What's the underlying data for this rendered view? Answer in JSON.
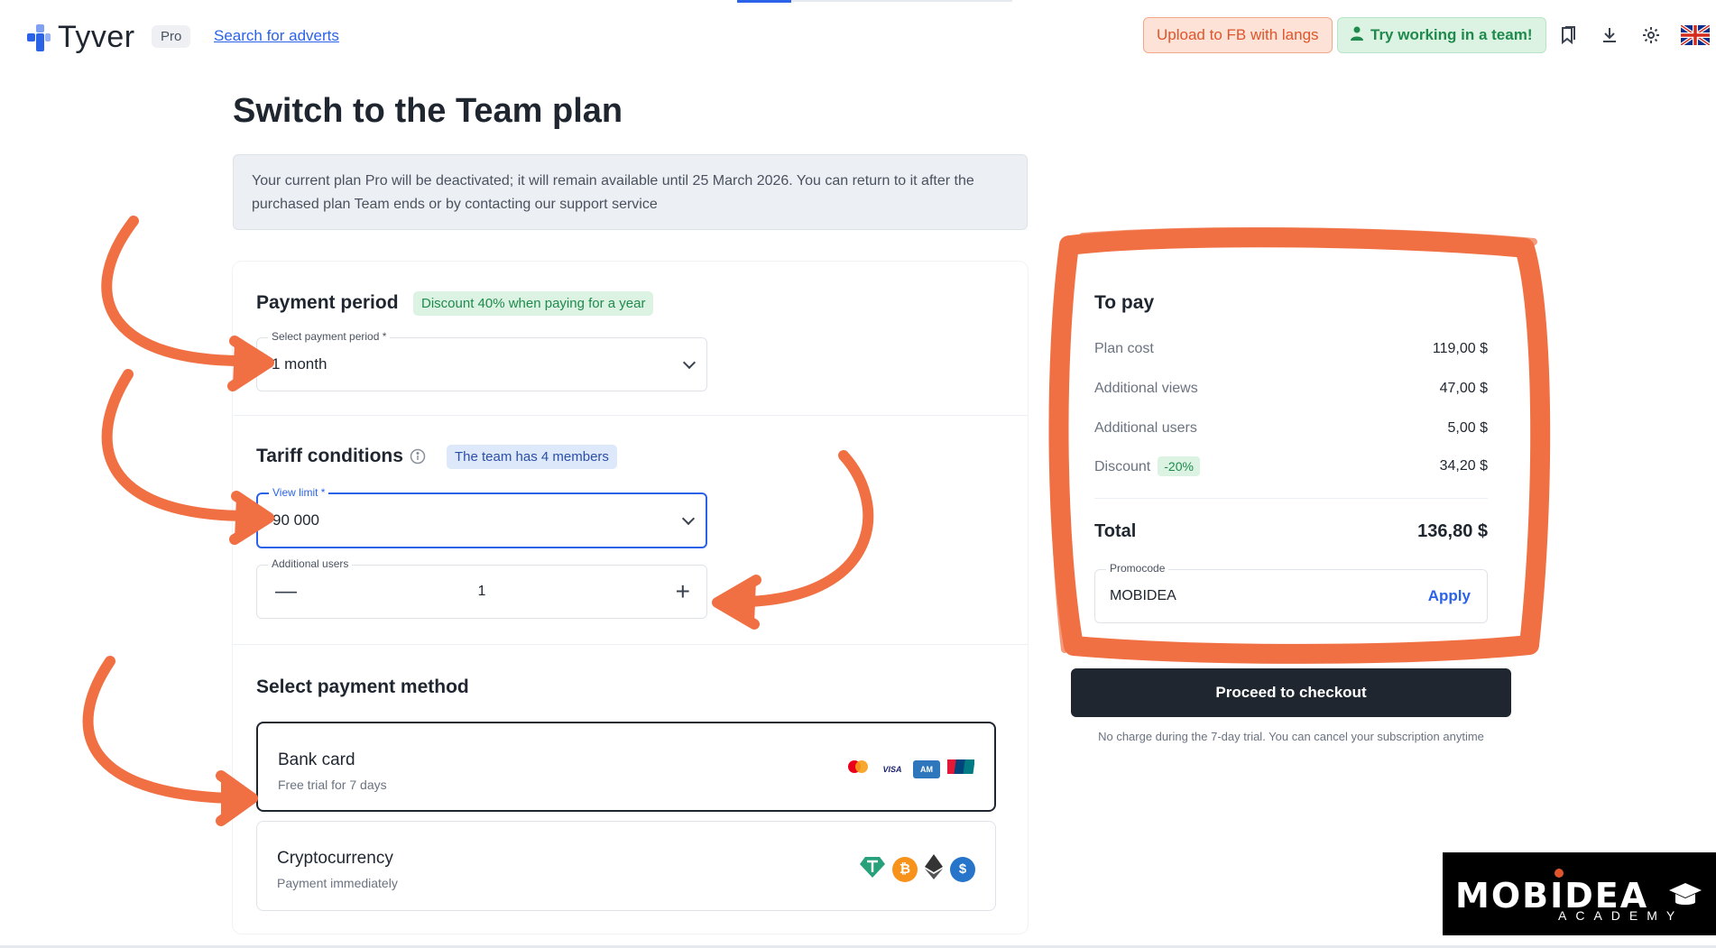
{
  "header": {
    "logo_text": "Tyver",
    "plan_badge": "Pro",
    "search_link": "Search for adverts",
    "upload_button": "Upload to FB with langs",
    "team_button": "Try working in a team!"
  },
  "page": {
    "title": "Switch to the Team plan",
    "notice": "Your current plan Pro will be deactivated; it will remain available until 25 March 2026. You can return to it after the purchased plan Team ends or by contacting our support service"
  },
  "payment_period": {
    "title": "Payment period",
    "discount_chip": "Discount 40% when paying for a year",
    "select_label": "Select payment period *",
    "select_value": "1 month"
  },
  "tariff": {
    "title": "Tariff conditions",
    "team_chip": "The team has 4 members",
    "view_limit_label": "View limit *",
    "view_limit_value": "90 000",
    "additional_users_label": "Additional users",
    "additional_users_value": "1"
  },
  "payment_method": {
    "title": "Select payment method",
    "options": [
      {
        "name": "Bank card",
        "subtitle": "Free trial for 7 days"
      },
      {
        "name": "Cryptocurrency",
        "subtitle": "Payment immediately"
      }
    ]
  },
  "summary": {
    "title": "To pay",
    "rows": [
      {
        "label": "Plan cost",
        "amount": "119,00 $"
      },
      {
        "label": "Additional views",
        "amount": "47,00 $"
      },
      {
        "label": "Additional users",
        "amount": "5,00 $"
      },
      {
        "label": "Discount",
        "amount": "34,20 $",
        "chip": "-20%"
      }
    ],
    "total_label": "Total",
    "total_amount": "136,80 $",
    "promo_label": "Promocode",
    "promo_value": "MOBIDEA",
    "promo_apply": "Apply"
  },
  "checkout": {
    "button": "Proceed to checkout",
    "note": "No charge during the 7-day trial. You can cancel your subscription anytime"
  },
  "watermark": {
    "brand": "MOBIDEA",
    "sub": "ACADEMY"
  },
  "colors": {
    "accent": "#2b63e8",
    "annotation": "#f07043",
    "dark": "#1f2630"
  }
}
